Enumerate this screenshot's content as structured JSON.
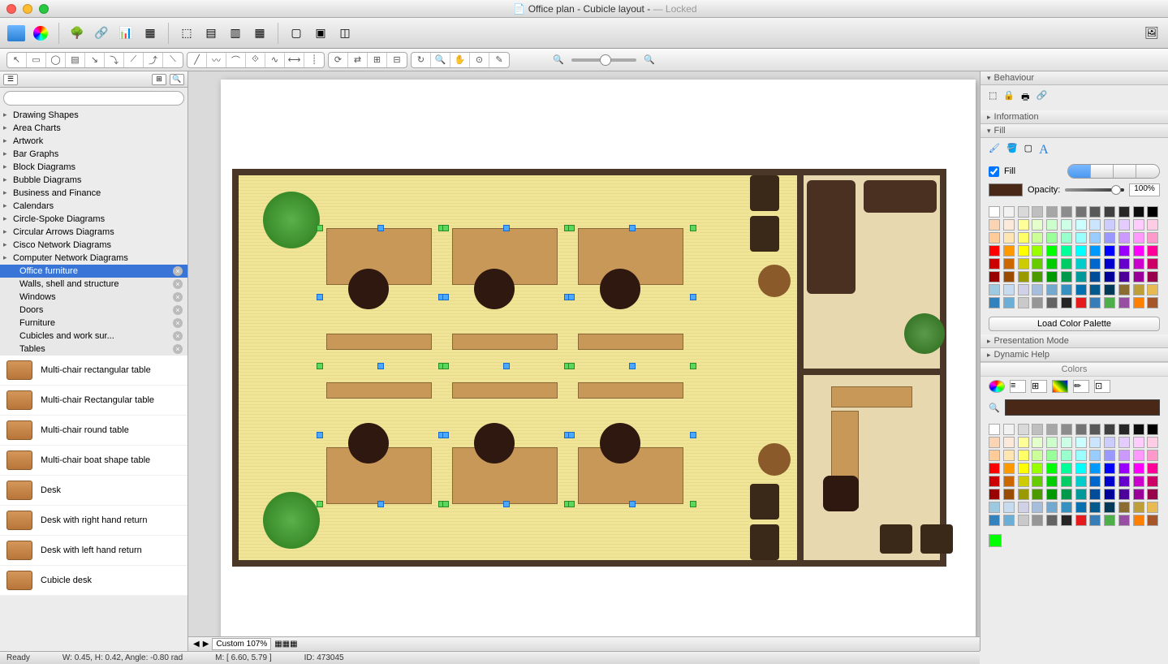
{
  "titlebar": {
    "doc_icon": "📄",
    "document": "Office plan - Cubicle layout -",
    "status": "— Locked"
  },
  "sidebar_left": {
    "search_placeholder": "",
    "categories": [
      "Drawing Shapes",
      "Area Charts",
      "Artwork",
      "Bar Graphs",
      "Block Diagrams",
      "Bubble Diagrams",
      "Business and Finance",
      "Calendars",
      "Circle-Spoke Diagrams",
      "Circular Arrows Diagrams",
      "Cisco Network Diagrams",
      "Computer Network Diagrams"
    ],
    "subs": [
      {
        "label": "Office furniture",
        "selected": true
      },
      {
        "label": "Walls, shell and structure",
        "selected": false
      },
      {
        "label": "Windows",
        "selected": false
      },
      {
        "label": "Doors",
        "selected": false
      },
      {
        "label": "Furniture",
        "selected": false
      },
      {
        "label": "Cubicles and work sur...",
        "selected": false
      },
      {
        "label": "Tables",
        "selected": false
      }
    ],
    "shapes": [
      "Multi-chair rectangular table",
      "Multi-chair Rectangular table",
      "Multi-chair round table",
      "Multi-chair boat shape table",
      "Desk",
      "Desk with right hand return",
      "Desk with left hand return",
      "Cubicle desk"
    ]
  },
  "sidebar_right": {
    "sections": {
      "behaviour": "Behaviour",
      "information": "Information",
      "fill": "Fill",
      "presentation": "Presentation Mode",
      "dynamic_help": "Dynamic Help",
      "colors": "Colors"
    },
    "fill": {
      "checkbox_label": "Fill",
      "opacity_label": "Opacity:",
      "opacity_value": "100%",
      "load_button": "Load Color Palette"
    }
  },
  "zoom": {
    "label": "Custom 107%"
  },
  "statusbar": {
    "ready": "Ready",
    "dims": "W: 0.45,  H: 0.42,  Angle: -0.80 rad",
    "mouse": "M: [ 6.60, 5.79 ]",
    "id": "ID: 473045"
  },
  "palette_colors": [
    "#ffffff",
    "#f2f2f2",
    "#d9d9d9",
    "#bfbfbf",
    "#a6a6a6",
    "#8c8c8c",
    "#737373",
    "#595959",
    "#404040",
    "#262626",
    "#0d0d0d",
    "#000000",
    "#fbd4b4",
    "#fde9d9",
    "#ffff99",
    "#e5ffcc",
    "#ccffcc",
    "#ccffe5",
    "#ccffff",
    "#cce5ff",
    "#ccccff",
    "#e5ccff",
    "#ffccff",
    "#ffcce5",
    "#ffcc99",
    "#ffe5b2",
    "#ffff66",
    "#ccff99",
    "#99ff99",
    "#99ffcc",
    "#99ffff",
    "#99ccff",
    "#9999ff",
    "#cc99ff",
    "#ff99ff",
    "#ff99cc",
    "#ff0000",
    "#ff9900",
    "#ffff00",
    "#99ff00",
    "#00ff00",
    "#00ff99",
    "#00ffff",
    "#0099ff",
    "#0000ff",
    "#9900ff",
    "#ff00ff",
    "#ff0099",
    "#cc0000",
    "#cc6600",
    "#cccc00",
    "#66cc00",
    "#00cc00",
    "#00cc66",
    "#00cccc",
    "#0066cc",
    "#0000cc",
    "#6600cc",
    "#cc00cc",
    "#cc0066",
    "#990000",
    "#994c00",
    "#999900",
    "#4c9900",
    "#009900",
    "#00994c",
    "#009999",
    "#004c99",
    "#000099",
    "#4c0099",
    "#990099",
    "#99004c",
    "#9ecae1",
    "#c6dbef",
    "#d0d1e6",
    "#a6bddb",
    "#74a9cf",
    "#3690c0",
    "#0570b0",
    "#045a8d",
    "#023858",
    "#8c6d31",
    "#bd9e39",
    "#e7ba52",
    "#3182bd",
    "#6baed6",
    "#c9c9c9",
    "#969696",
    "#636363",
    "#252525",
    "#e41a1c",
    "#377eb8",
    "#4daf4a",
    "#984ea3",
    "#ff7f00",
    "#a65628"
  ]
}
